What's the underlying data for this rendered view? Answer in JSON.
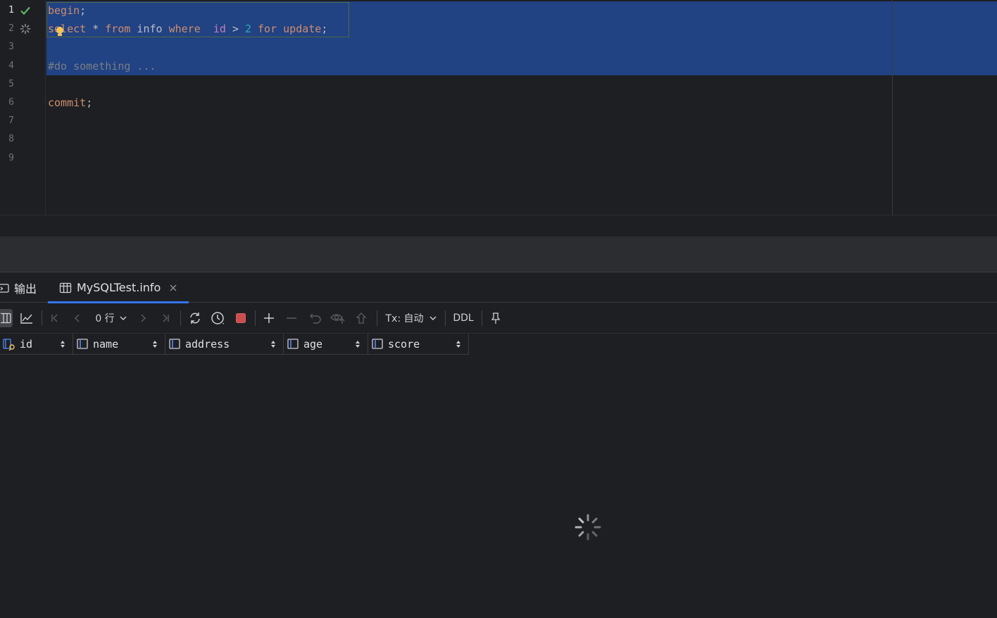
{
  "editor": {
    "line_numbers": [
      "1",
      "2",
      "3",
      "4",
      "5",
      "6",
      "7",
      "8",
      "9"
    ],
    "lines": [
      {
        "tokens": [
          {
            "t": "begin",
            "c": "kw"
          },
          {
            "t": ";",
            "c": "id"
          }
        ]
      },
      {
        "tokens": [
          {
            "t": "select",
            "c": "kw"
          },
          {
            "t": " * ",
            "c": "id"
          },
          {
            "t": "from",
            "c": "kw"
          },
          {
            "t": " info ",
            "c": "id"
          },
          {
            "t": "where",
            "c": "kw"
          },
          {
            "t": "  ",
            "c": "id"
          },
          {
            "t": "id",
            "c": "col"
          },
          {
            "t": " > ",
            "c": "id"
          },
          {
            "t": "2",
            "c": "num"
          },
          {
            "t": " ",
            "c": "id"
          },
          {
            "t": "for",
            "c": "kw"
          },
          {
            "t": " ",
            "c": "id"
          },
          {
            "t": "update",
            "c": "kw"
          },
          {
            "t": ";",
            "c": "id"
          }
        ]
      },
      {
        "tokens": []
      },
      {
        "tokens": [
          {
            "t": "#do something ...",
            "c": "cm"
          }
        ]
      },
      {
        "tokens": []
      },
      {
        "tokens": [
          {
            "t": "commit",
            "c": "kw"
          },
          {
            "t": ";",
            "c": "id"
          }
        ]
      },
      {
        "tokens": []
      },
      {
        "tokens": []
      },
      {
        "tokens": []
      }
    ],
    "gutter_icons": [
      "check-icon",
      "loading-spinner-icon"
    ]
  },
  "results_panel": {
    "tabs": [
      {
        "label": "输出",
        "icon": "console-icon"
      },
      {
        "label": "MySQLTest.info",
        "icon": "table-icon",
        "active": true
      }
    ],
    "toolbar": {
      "row_count": "0 行",
      "tx_mode": "Tx: 自动",
      "ddl": "DDL"
    },
    "columns": [
      {
        "name": "id",
        "icon": "primary-key-column-icon"
      },
      {
        "name": "name",
        "icon": "column-icon"
      },
      {
        "name": "address",
        "icon": "column-icon"
      },
      {
        "name": "age",
        "icon": "column-icon"
      },
      {
        "name": "score",
        "icon": "column-icon"
      }
    ],
    "status": "loading"
  },
  "colors": {
    "background": "#1e1f22",
    "selection": "#214283",
    "keyword": "#cf8e6d",
    "number": "#2aacb8",
    "column_ref": "#c77dbb",
    "comment": "#7a7e85",
    "accent_tab": "#3574f0",
    "stop_button": "#c94f4f"
  }
}
